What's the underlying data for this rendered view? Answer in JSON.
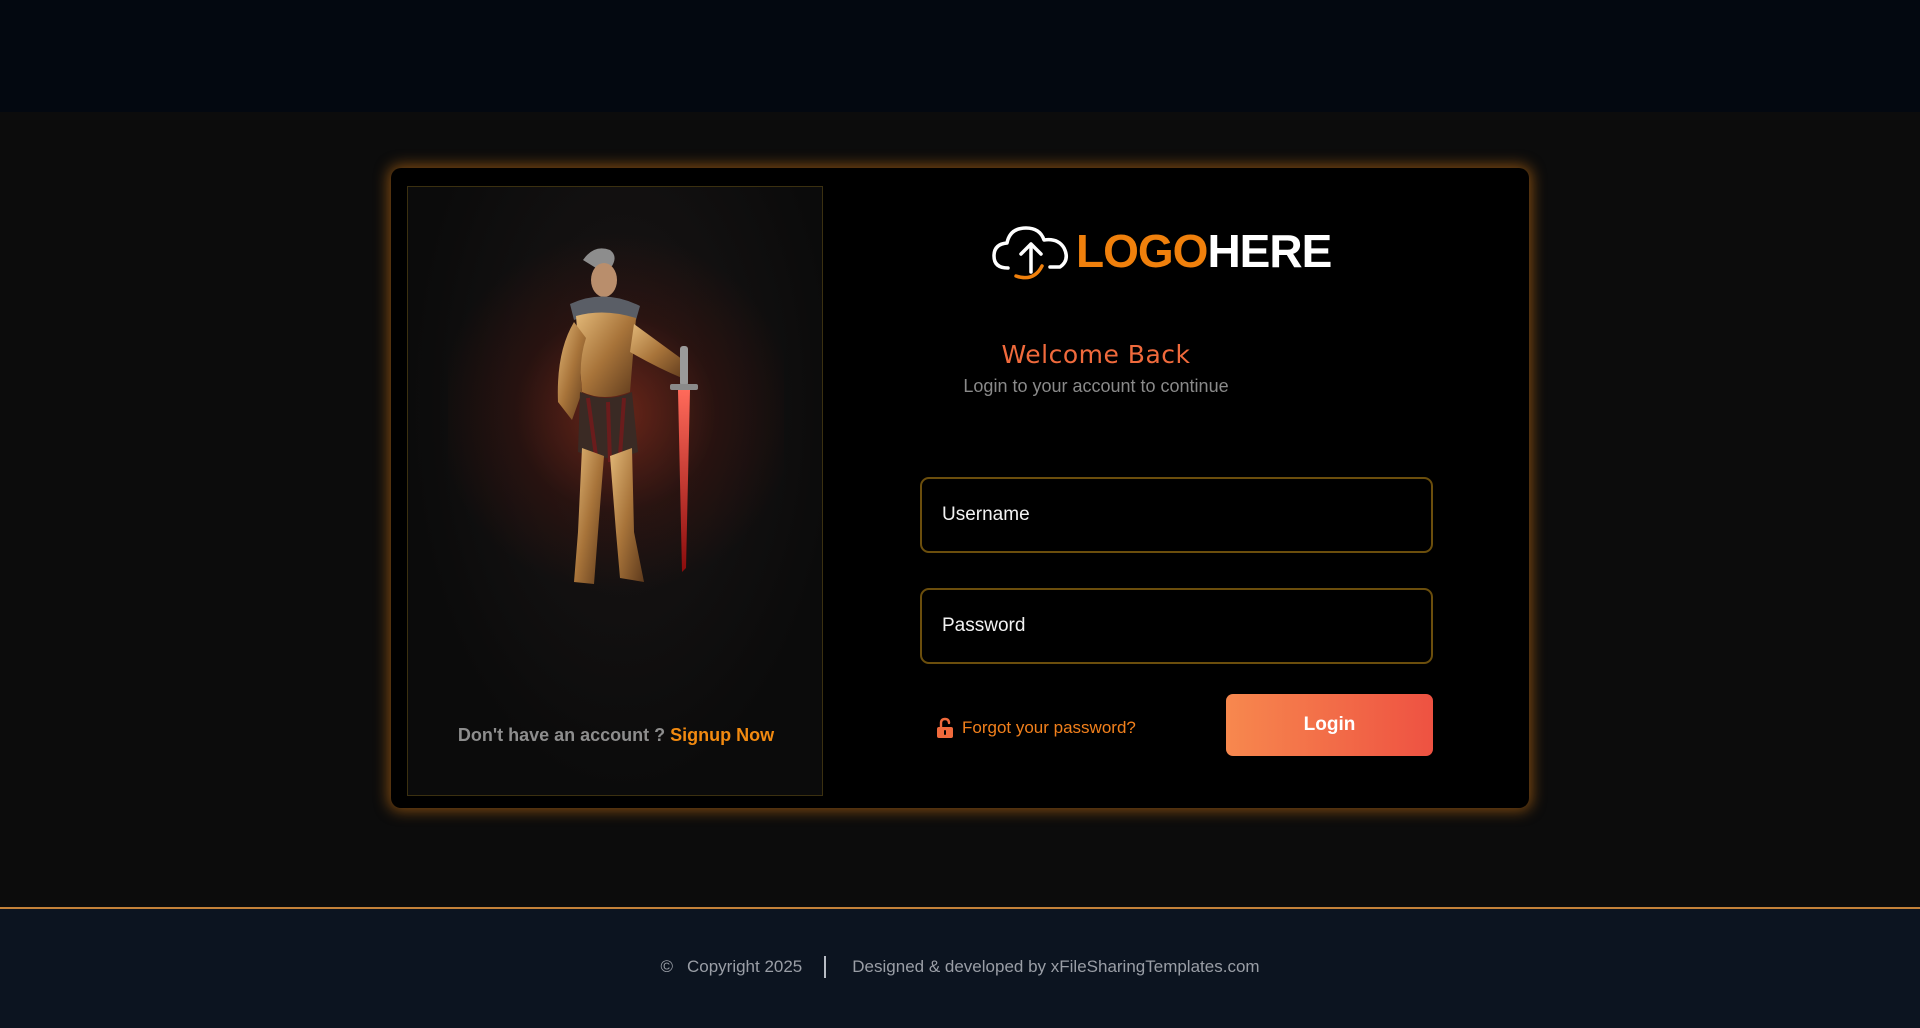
{
  "logo": {
    "part1": "LOGO",
    "part2": "HERE"
  },
  "auth": {
    "title": "Welcome Back",
    "subtitle": "Login to your account to continue",
    "username_placeholder": "Username",
    "password_placeholder": "Password",
    "forgot_label": "Forgot your password?",
    "login_label": "Login"
  },
  "signup": {
    "prompt": "Don't have an account ?",
    "link": "Signup Now"
  },
  "footer": {
    "copyright": "Copyright 2025",
    "credit": "Designed & developed by xFileSharingTemplates.com"
  },
  "colors": {
    "accent": "#f0800c",
    "welcome": "#f06a3c",
    "button_start": "#f7884e",
    "button_end": "#ee5242",
    "card_glow": "#d67814"
  },
  "icons": [
    "cloud-upload-icon",
    "lock-open-icon",
    "copyright-icon"
  ]
}
